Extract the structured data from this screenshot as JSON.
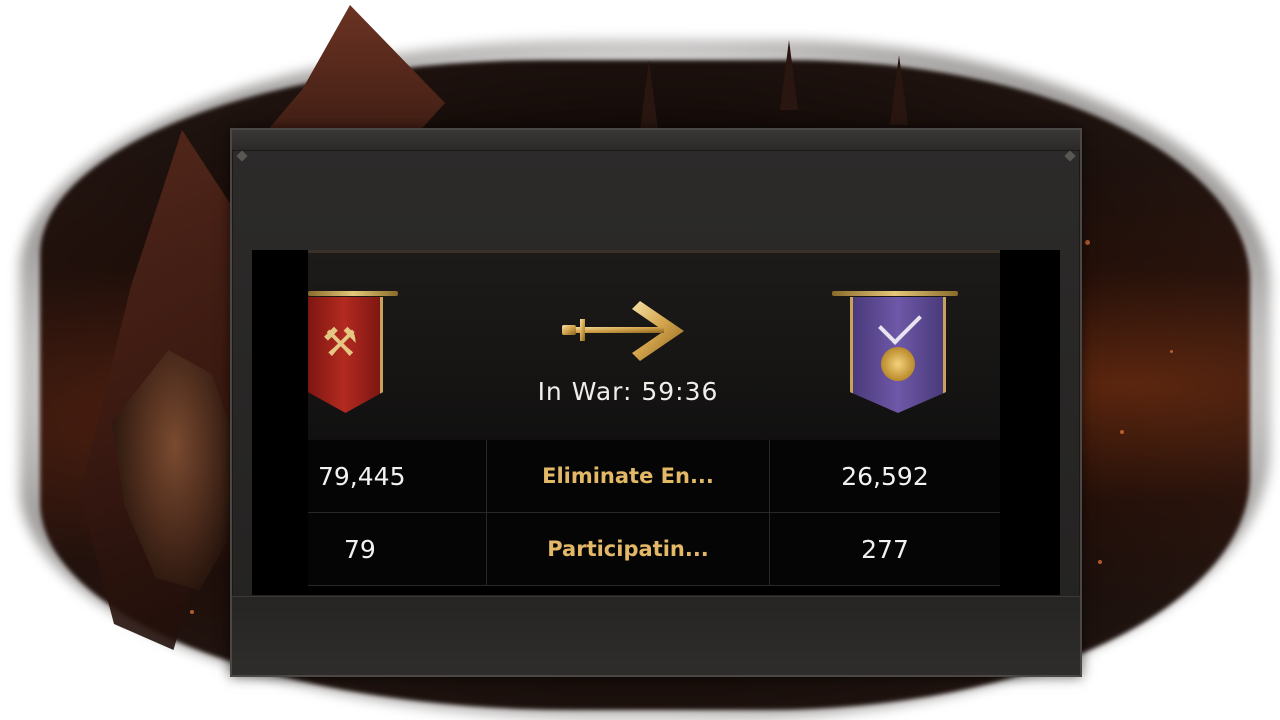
{
  "war": {
    "status_label": "In War: 59:36"
  },
  "factions": {
    "left": {
      "banner_color": "#b32a20",
      "emblem": "axe-icon"
    },
    "right": {
      "banner_color": "#6e58a8",
      "emblem": "crest-icon"
    }
  },
  "stats": [
    {
      "left_value": "79,445",
      "label": "Eliminate En...",
      "right_value": "26,592"
    },
    {
      "left_value": "79",
      "label": "Participatin...",
      "right_value": "277"
    }
  ],
  "colors": {
    "accent_gold": "#e3b867",
    "panel": "#2c2b2a"
  }
}
